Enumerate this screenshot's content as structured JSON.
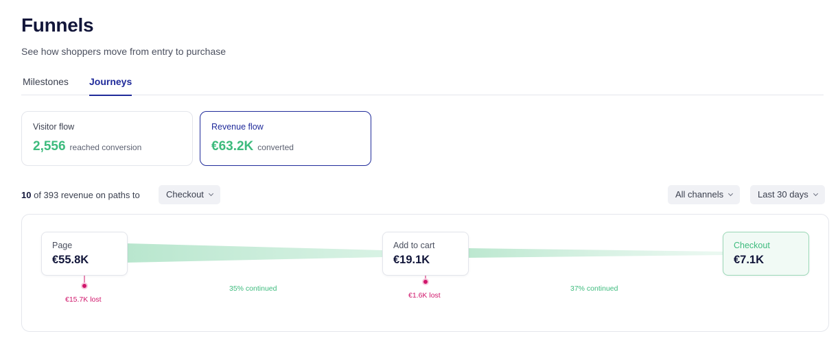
{
  "header": {
    "title": "Funnels",
    "subtitle": "See how shoppers move from entry to purchase"
  },
  "tabs": [
    {
      "label": "Milestones",
      "active": false
    },
    {
      "label": "Journeys",
      "active": true
    }
  ],
  "cards": [
    {
      "label": "Visitor flow",
      "value": "2,556",
      "suffix": "reached conversion",
      "selected": false
    },
    {
      "label": "Revenue flow",
      "value": "€63.2K",
      "suffix": "converted",
      "selected": true
    }
  ],
  "summary": {
    "count": "10",
    "text": "of 393 revenue on paths to"
  },
  "filters": {
    "destination": "Checkout",
    "channel": "All channels",
    "range": "Last 30 days"
  },
  "flow": {
    "nodes": [
      {
        "label": "Page",
        "value": "€55.8K"
      },
      {
        "label": "Add to cart",
        "value": "€19.1K"
      },
      {
        "label": "Checkout",
        "value": "€7.1K"
      }
    ],
    "losses": [
      "€15.7K lost",
      "€1.6K lost"
    ],
    "continued": [
      "35% continued",
      "37% continued"
    ]
  },
  "colors": {
    "accent": "#1f2a9a",
    "positive": "#3dbb7d",
    "loss": "#d0166b"
  }
}
